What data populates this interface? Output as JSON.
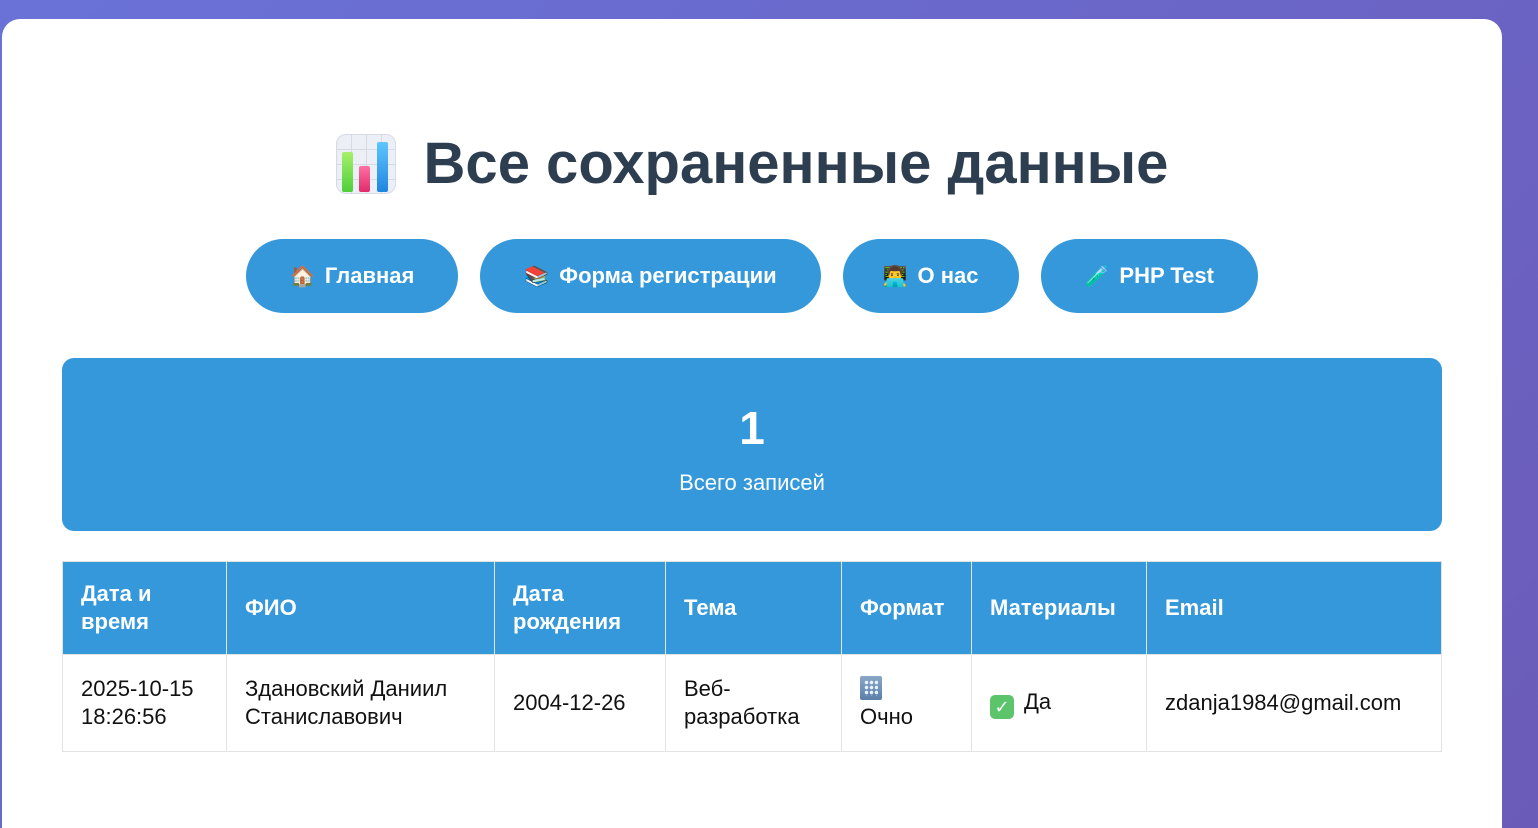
{
  "page": {
    "title": "Все сохраненные данные",
    "title_icon": "bar-chart-icon"
  },
  "nav": [
    {
      "icon": "🏠",
      "label": "Главная"
    },
    {
      "icon": "📚",
      "label": "Форма регистрации"
    },
    {
      "icon": "👨‍💻",
      "label": "О нас"
    },
    {
      "icon": "🧪",
      "label": "PHP Test"
    }
  ],
  "stats": {
    "count": "1",
    "label": "Всего записей"
  },
  "table": {
    "headers": [
      "Дата и время",
      "ФИО",
      "Дата рождения",
      "Тема",
      "Формат",
      "Материалы",
      "Email"
    ],
    "rows": [
      {
        "datetime": "2025-10-15 18:26:56",
        "fio": "Здановский Даниил Станиславович",
        "birth": "2004-12-26",
        "topic": "Веб-разработка",
        "format_icon": "office-building-icon",
        "format": "Очно",
        "materials_icon": "check-mark-icon",
        "materials": "Да",
        "email": "zdanja1984@gmail.com"
      }
    ]
  },
  "colors": {
    "accent": "#3498db",
    "title": "#2c3e50",
    "background_start": "#6a72d8",
    "background_end": "#6b5bb8"
  }
}
